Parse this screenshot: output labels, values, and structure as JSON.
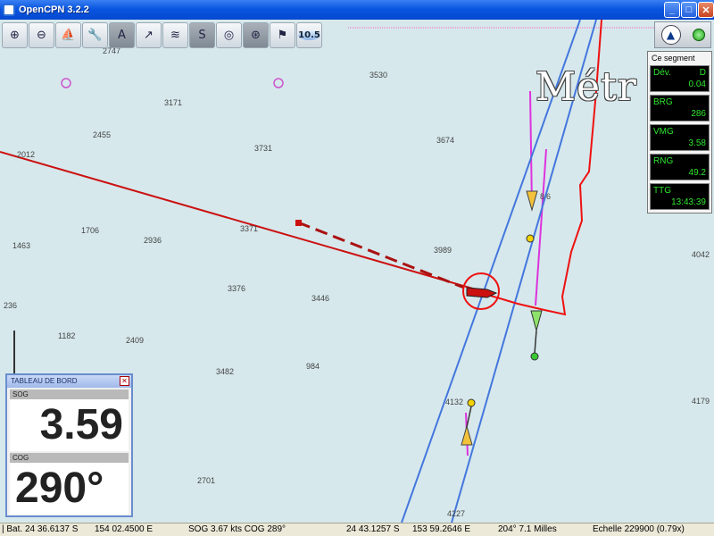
{
  "window": {
    "title": "OpenCPN 3.2.2",
    "min": "_",
    "max": "□",
    "close": "✕"
  },
  "toolbar": {
    "buttons": [
      {
        "name": "zoom-in-icon",
        "glyph": "⊕"
      },
      {
        "name": "zoom-out-icon",
        "glyph": "⊖"
      },
      {
        "name": "boat-icon",
        "glyph": "⛵"
      },
      {
        "name": "settings-icon",
        "glyph": "🔧"
      },
      {
        "name": "text-tool-icon",
        "glyph": "A"
      },
      {
        "name": "route-manager-icon",
        "glyph": "↗"
      },
      {
        "name": "tracks-icon",
        "glyph": "≋"
      },
      {
        "name": "route-draw-icon",
        "glyph": "S"
      },
      {
        "name": "mob-icon",
        "glyph": "◎"
      },
      {
        "name": "ais-icon",
        "glyph": "⊛"
      },
      {
        "name": "tide-icon",
        "glyph": "⚑"
      }
    ],
    "zoom_label": "10.5"
  },
  "chart": {
    "big_label": "Métr",
    "depths": [
      {
        "t": "2747"
      },
      {
        "t": "3530"
      },
      {
        "t": "3171"
      },
      {
        "t": "2455"
      },
      {
        "t": "3731"
      },
      {
        "t": "3674"
      },
      {
        "t": "2012"
      },
      {
        "t": "3371"
      },
      {
        "t": "1706"
      },
      {
        "t": "2936"
      },
      {
        "t": "1463"
      },
      {
        "t": "3989"
      },
      {
        "t": "3376"
      },
      {
        "t": "3446"
      },
      {
        "t": "236"
      },
      {
        "t": "1182"
      },
      {
        "t": "2409"
      },
      {
        "t": "3482"
      },
      {
        "t": "984"
      },
      {
        "t": "4132"
      },
      {
        "t": "2701"
      },
      {
        "t": "4227"
      },
      {
        "t": "4042"
      },
      {
        "t": "4179"
      },
      {
        "t": "8"
      },
      {
        "t": "6"
      }
    ],
    "colors": {
      "water": "#d6e8ec",
      "track": "#cc1111",
      "route": "#4477dd",
      "waypoint": "#dd33dd"
    }
  },
  "route_panel": {
    "title": "Ce segment",
    "fields": [
      {
        "label": "Dév.",
        "unit": "D",
        "value": "0.04"
      },
      {
        "label": "BRG",
        "unit": "",
        "value": "286"
      },
      {
        "label": "VMG",
        "unit": "",
        "value": "3.58"
      },
      {
        "label": "RNG",
        "unit": "",
        "value": "49.2"
      },
      {
        "label": "TTG",
        "unit": "",
        "value": "13:43:39"
      }
    ]
  },
  "dashboard": {
    "title": "TABLEAU DE BORD",
    "close": "✕",
    "sog_caption": "SOG",
    "sog_value": "3.59",
    "cog_caption": "COG",
    "cog_value": "290°"
  },
  "status": {
    "lat": "| Bat. 24 36.6137 S",
    "lon": "154 02.4500 E",
    "sog_cog": "SOG 3.67 kts  COG 289°",
    "cursor_lat": "24 43.1257 S",
    "cursor_lon": "153 59.2646 E",
    "brg_dist": "204°  7.1 Milles",
    "scale": "Echelle 229900 (0.79x)"
  }
}
